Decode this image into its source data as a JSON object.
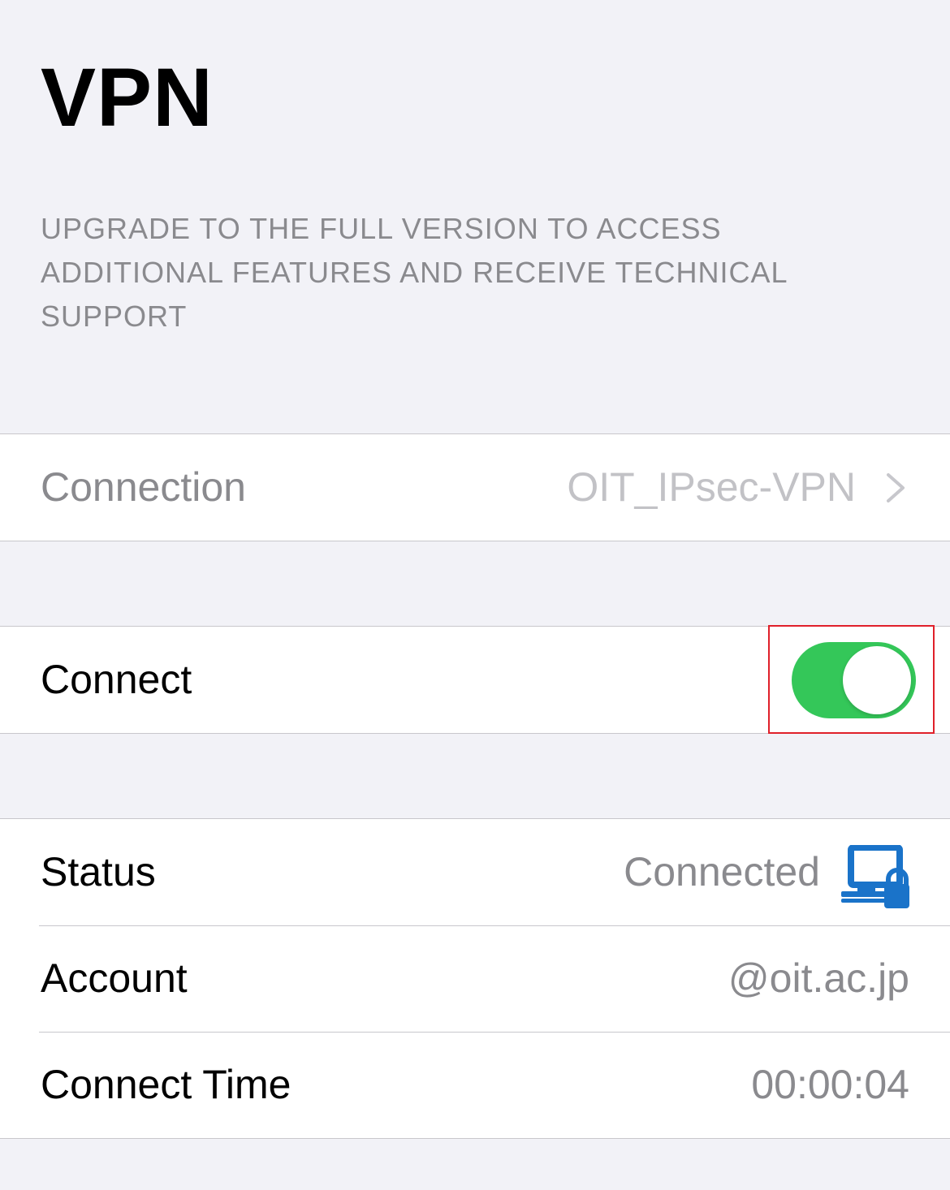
{
  "header": {
    "title": "VPN",
    "upgrade_note": "UPGRADE TO THE FULL VERSION TO ACCESS ADDITIONAL FEATURES AND RECEIVE TECHNICAL SUPPORT"
  },
  "connection": {
    "label": "Connection",
    "value": "OIT_IPsec-VPN",
    "icon": "chevron-right-icon"
  },
  "connect": {
    "label": "Connect",
    "toggle_on": true,
    "toggle_color": "#34c759",
    "highlight_color": "#e0202a"
  },
  "details": {
    "status_label": "Status",
    "status_value": "Connected",
    "status_icon": "computer-lock-icon",
    "status_icon_color": "#1a73c9",
    "account_label": "Account",
    "account_value": "@oit.ac.jp",
    "connect_time_label": "Connect Time",
    "connect_time_value": "00:00:04"
  }
}
